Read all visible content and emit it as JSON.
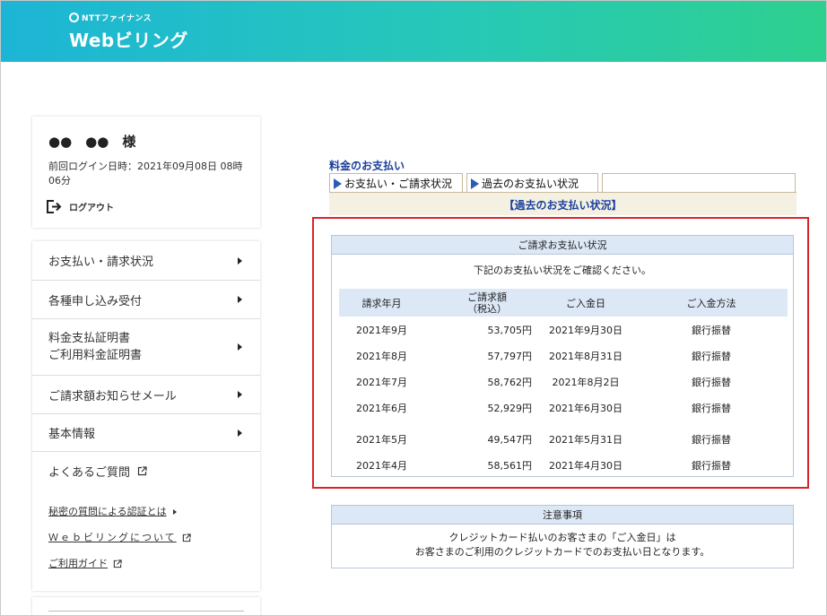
{
  "header": {
    "brand_small": "NTTファイナンス",
    "brand_main": "Webビリング"
  },
  "user": {
    "name": "●●　●●　様",
    "last_login": "前回ログイン日時：2021年09月08日 08時06分",
    "logout_label": "ログアウト"
  },
  "menu": {
    "items": [
      {
        "label": "お支払い・請求状況"
      },
      {
        "label": "各種申し込み受付"
      },
      {
        "label": "料金支払証明書",
        "label2": "ご利用料金証明書"
      },
      {
        "label": "ご請求額お知らせメール"
      },
      {
        "label": "基本情報"
      },
      {
        "label": "よくあるご質問"
      }
    ],
    "links": [
      {
        "label": "秘密の質問による認証とは"
      },
      {
        "label": "Ｗｅｂビリングについて"
      },
      {
        "label": "ご利用ガイド"
      }
    ]
  },
  "main": {
    "section_title": "料金のお支払い",
    "tabs": [
      {
        "label": "お支払い・ご請求状況"
      },
      {
        "label": "過去のお支払い状況"
      }
    ],
    "active_tab_label": "【過去のお支払い状況】",
    "status_panel": {
      "title": "ご請求お支払い状況",
      "intro": "下記のお支払い状況をご確認ください。",
      "columns": {
        "month": "請求年月",
        "amount_line1": "ご請求額",
        "amount_line2": "（税込）",
        "paid_date": "ご入金日",
        "method": "ご入金方法"
      },
      "rows": [
        {
          "month": "2021年9月",
          "amount": "53,705円",
          "paid_date": "2021年9月30日",
          "method": "銀行振替"
        },
        {
          "month": "2021年8月",
          "amount": "57,797円",
          "paid_date": "2021年8月31日",
          "method": "銀行振替"
        },
        {
          "month": "2021年7月",
          "amount": "58,762円",
          "paid_date": "2021年8月2日",
          "method": "銀行振替"
        },
        {
          "month": "2021年6月",
          "amount": "52,929円",
          "paid_date": "2021年6月30日",
          "method": "銀行振替"
        },
        {
          "month": "2021年5月",
          "amount": "49,547円",
          "paid_date": "2021年5月31日",
          "method": "銀行振替"
        },
        {
          "month": "2021年4月",
          "amount": "58,561円",
          "paid_date": "2021年4月30日",
          "method": "銀行振替"
        }
      ]
    },
    "notice_panel": {
      "title": "注意事項",
      "line1": "クレジットカード払いのお客さまの「ご入金日」は",
      "line2": "お客さまのご利用のクレジットカードでのお支払い日となります。"
    }
  },
  "colors": {
    "header_gradient_start": "#1db5d6",
    "header_gradient_end": "#2ed08f",
    "link_blue": "#1a3f9c",
    "highlight_red": "#d9252a",
    "panel_head_bg": "#dde8f7"
  }
}
